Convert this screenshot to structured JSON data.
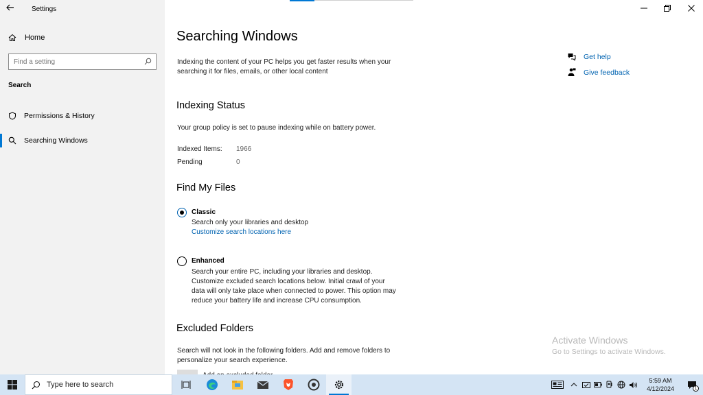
{
  "window": {
    "app_title": "Settings"
  },
  "sidebar": {
    "home_label": "Home",
    "search_placeholder": "Find a setting",
    "section_label": "Search",
    "items": [
      {
        "label": "Permissions & History",
        "icon": "shield-icon",
        "active": false
      },
      {
        "label": "Searching Windows",
        "icon": "search-icon",
        "active": true
      }
    ]
  },
  "main": {
    "title": "Searching Windows",
    "intro": "Indexing the content of your PC helps you get faster results when your searching it for files, emails, or other local content",
    "indexing_status": {
      "heading": "Indexing Status",
      "policy_text": "Your group policy is set to pause indexing while on battery power.",
      "indexed_label": "Indexed Items:",
      "indexed_value": "1966",
      "pending_label": "Pending",
      "pending_value": "0"
    },
    "find_my_files": {
      "heading": "Find My Files",
      "classic": {
        "label": "Classic",
        "desc": "Search only your libraries and desktop",
        "link": "Customize search locations here",
        "selected": true
      },
      "enhanced": {
        "label": "Enhanced",
        "desc_lines": [
          "Search your entire PC, including your libraries and desktop.",
          "Customize excluded search locations below. Initial crawl of your",
          "data will only take place when connected to power. This option may",
          "reduce your battery life and increase CPU consumption."
        ],
        "selected": false
      }
    },
    "excluded_folders": {
      "heading": "Excluded Folders",
      "desc_lines": [
        "Search will not look in the following folders. Add and remove folders to",
        "personalize your search experience."
      ],
      "add_label": "Add an excluded folder"
    },
    "side_links": {
      "help": "Get help",
      "feedback": "Give feedback"
    },
    "watermark": {
      "line1": "Activate Windows",
      "line2": "Go to Settings to activate Windows."
    }
  },
  "taskbar": {
    "search_placeholder": "Type here to search",
    "apps": [
      "task-view-icon",
      "edge-icon",
      "file-explorer-icon",
      "mail-icon",
      "brave-icon",
      "media-app-icon",
      "settings-icon"
    ],
    "time": "5:59 AM",
    "date": "4/12/2024",
    "notification_count": "1"
  },
  "colors": {
    "accent": "#0078d4",
    "link": "#0063b1",
    "sidebar_bg": "#f2f2f2",
    "taskbar_bg": "#d4e4f4"
  }
}
